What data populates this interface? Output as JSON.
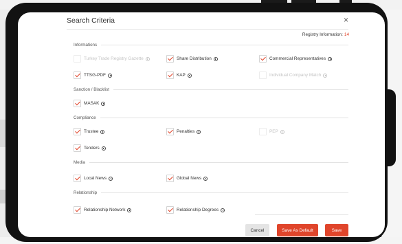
{
  "modal": {
    "title": "Search Criteria",
    "close_glyph": "×",
    "registry_label": "Registry Information:",
    "registry_count": "14"
  },
  "sections": {
    "informations": "Informations",
    "sanction": "Sanction / Blacklist",
    "compliance": "Compliance",
    "media": "Media",
    "relationship": "Relationship"
  },
  "options": {
    "trade_gazette": {
      "label": "Turkey Trade Registry Gazette",
      "checked": false,
      "disabled": true
    },
    "share_distribution": {
      "label": "Share Distribution",
      "checked": true,
      "disabled": false
    },
    "commercial_reps": {
      "label": "Commercial Representatives",
      "checked": true,
      "disabled": false
    },
    "ttsg_pdf": {
      "label": "TTSG-PDF",
      "checked": true,
      "disabled": false
    },
    "kap": {
      "label": "KAP",
      "checked": true,
      "disabled": false
    },
    "individual_match": {
      "label": "Individual Company Match",
      "checked": false,
      "disabled": true
    },
    "masak": {
      "label": "MASAK",
      "checked": true,
      "disabled": false
    },
    "trustee": {
      "label": "Trustee",
      "checked": true,
      "disabled": false
    },
    "penalties": {
      "label": "Penalties",
      "checked": true,
      "disabled": false
    },
    "pep": {
      "label": "PEP",
      "checked": false,
      "disabled": true
    },
    "tenders": {
      "label": "Tenders",
      "checked": true,
      "disabled": false
    },
    "local_news": {
      "label": "Local News",
      "checked": true,
      "disabled": false
    },
    "global_news": {
      "label": "Global News",
      "checked": true,
      "disabled": false
    },
    "rel_network": {
      "label": "Relationship Network",
      "checked": true,
      "disabled": false
    },
    "rel_degrees": {
      "label": "Relationship Degrees",
      "checked": true,
      "disabled": false
    }
  },
  "footer": {
    "cancel_label": "Cancel",
    "default_label": "Save As Default",
    "save_label": "Save"
  },
  "colors": {
    "accent": "#e0452b",
    "cancel_bg": "#e4e4e4"
  },
  "icons": {
    "close": "close-icon",
    "info": "info-icon",
    "check": "checkmark-icon"
  }
}
